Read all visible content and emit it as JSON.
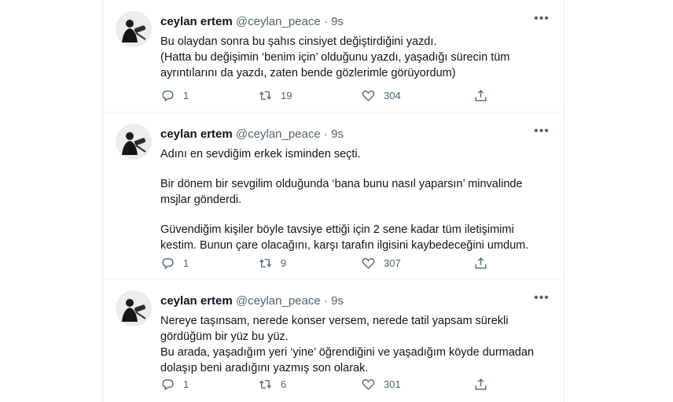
{
  "tweets": [
    {
      "name": "ceylan ertem",
      "handle": "@ceylan_peace",
      "separator": "·",
      "time": "9s",
      "paragraphs": [
        "Bu olaydan sonra bu şahıs cinsiyet değiştirdiğini yazdı.",
        "(Hatta bu değişimin ‘benim için’ olduğunu yazdı, yaşadığı sürecin tüm ayrıntılarını da yazdı, zaten bende gözlerimle görüyordum)"
      ],
      "replies": "1",
      "retweets": "19",
      "likes": "304"
    },
    {
      "name": "ceylan ertem",
      "handle": "@ceylan_peace",
      "separator": "·",
      "time": "9s",
      "paragraphs": [
        "Adını en sevdiğim erkek isminden seçti.",
        "Bir dönem bir sevgilim olduğunda ‘bana bunu nasıl yaparsın’ minvalinde msjlar gönderdi.",
        "Güvendiğim kişiler böyle tavsiye ettiği için 2 sene kadar tüm iletişimimi kestim. Bunun çare olacağını, karşı tarafın ilgisini kaybedeceğini umdum."
      ],
      "replies": "1",
      "retweets": "9",
      "likes": "307"
    },
    {
      "name": "ceylan ertem",
      "handle": "@ceylan_peace",
      "separator": "·",
      "time": "9s",
      "paragraphs": [
        "Nereye taşınsam, nerede konser versem, nerede tatil yapsam sürekli gördüğüm bir yüz bu yüz.",
        "Bu arada, yaşadığım yeri ‘yine’ öğrendiğini ve yaşadığım köyde durmadan dolaşıp beni aradığını yazmış son olarak."
      ],
      "replies": "1",
      "retweets": "6",
      "likes": "301"
    }
  ],
  "icons": {
    "reply": "reply-icon",
    "retweet": "retweet-icon",
    "like": "heart-icon",
    "share": "share-icon",
    "more": "more-icon"
  },
  "colors": {
    "text": "#0f1419",
    "secondary": "#536471",
    "divider": "#eff3f4"
  }
}
